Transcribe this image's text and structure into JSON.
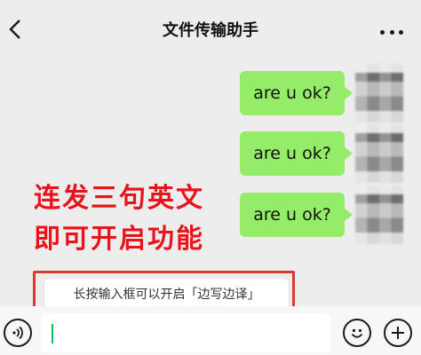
{
  "header": {
    "title": "文件传输助手"
  },
  "messages": [
    {
      "text": "are u ok?"
    },
    {
      "text": "are u ok?"
    },
    {
      "text": "are u ok?"
    }
  ],
  "overlay": {
    "line1": "连发三句英文",
    "line2": "即可开启功能"
  },
  "hint": {
    "text": "长按输入框可以开启「边写边译」"
  },
  "colors": {
    "bubble": "#95ec69",
    "overlay_text": "#e8141c",
    "highlight_border": "#d83a35",
    "caret": "#07c160"
  }
}
